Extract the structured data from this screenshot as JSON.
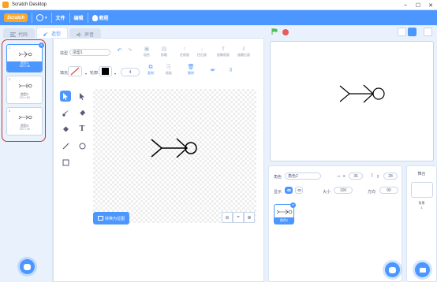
{
  "window": {
    "title": "Scratch Desktop",
    "controls": [
      "–",
      "☐",
      "✕"
    ]
  },
  "menubar": {
    "logo": "Scratch",
    "file": "文件",
    "edit": "编辑",
    "tutorials": "教程"
  },
  "tabs": [
    {
      "label": "代码"
    },
    {
      "label": "造型"
    },
    {
      "label": "声音"
    }
  ],
  "costumes": [
    {
      "num": "1",
      "name": "造型1",
      "size": "130 x 48",
      "selected": true
    },
    {
      "num": "2",
      "name": "造型2",
      "size": "120 x 50",
      "selected": false
    },
    {
      "num": "3",
      "name": "造型3",
      "size": "120 x 49",
      "selected": false
    }
  ],
  "editor": {
    "costume_label": "造型",
    "costume_name": "造型1",
    "fill_label": "填充",
    "outline_label": "轮廓",
    "outline_width": "4",
    "buttons": {
      "group": "组合",
      "ungroup": "拆散",
      "forward": "往前放",
      "backward": "往后放",
      "front": "放最前面",
      "back": "放最后面",
      "copy": "复制",
      "paste": "粘贴",
      "delete": "删除",
      "flip_h": "",
      "flip_v": ""
    },
    "convert_button": "转换为位图"
  },
  "sprite_info": {
    "sprite_label": "角色",
    "sprite_name": "角色2",
    "x_label": "x",
    "x_value": "36",
    "y_label": "y",
    "y_value": "28",
    "show_label": "显示",
    "size_label": "大小",
    "size_value": "100",
    "direction_label": "方向",
    "direction_value": "90"
  },
  "sprites": [
    {
      "name": "角色2"
    }
  ],
  "stage_pane": {
    "title": "舞台",
    "backdrops_label": "背景",
    "backdrops_count": "1"
  },
  "colors": {
    "accent": "#4c97ff",
    "outline_highlight": "#c0392b",
    "stop": "#ec5959",
    "flag": "#4cbf56"
  }
}
